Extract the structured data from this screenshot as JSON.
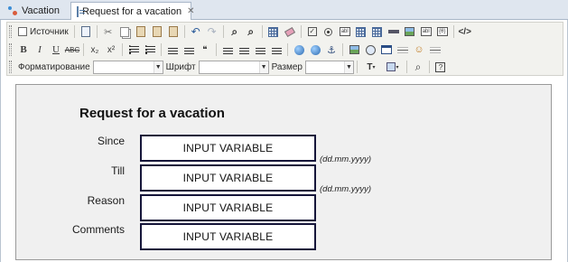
{
  "tabs": [
    {
      "label": "Vacation",
      "icon": "vacation-icon"
    },
    {
      "label": "Request for a vacation",
      "icon": "form-icon",
      "active": true,
      "closable": true
    }
  ],
  "toolbar": {
    "row1": {
      "source_label": "Источник"
    },
    "row3": {
      "format_label": "Форматирование",
      "font_label": "Шрифт",
      "size_label": "Размер",
      "format_value": "",
      "font_value": "",
      "size_value": "",
      "text_color_label": "T"
    }
  },
  "form": {
    "title": "Request for a vacation",
    "rows": [
      {
        "label": "Since",
        "field": "INPUT VARIABLE",
        "hint": "(dd.mm.yyyy)"
      },
      {
        "label": "Till",
        "field": "INPUT VARIABLE",
        "hint": "(dd.mm.yyyy)"
      },
      {
        "label": "Reason",
        "field": "INPUT VARIABLE",
        "hint": ""
      },
      {
        "label": "Comments",
        "field": "INPUT VARIABLE",
        "hint": ""
      }
    ]
  },
  "colors": {
    "tab_strip": "#dfe6ef",
    "toolbar_bg": "#f2f2ee",
    "content_bg": "#f0f0f0",
    "field_border": "#16163a"
  }
}
